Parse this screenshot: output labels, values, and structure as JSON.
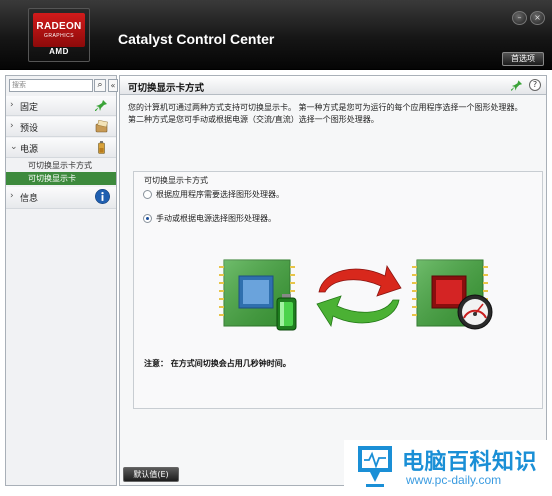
{
  "window": {
    "logo_brand": "RADEON",
    "logo_sub": "GRAPHICS",
    "logo_maker": "AMD",
    "title": "Catalyst Control Center",
    "minimize_symbol": "–",
    "close_symbol": "×",
    "preferences_label": "首选项"
  },
  "sidebar": {
    "search_placeholder": "搜索",
    "search_symbol": "⌕",
    "collapse_symbol": "«",
    "items": [
      {
        "label": "固定",
        "arrow": "›",
        "icon": "pin-icon"
      },
      {
        "label": "预设",
        "arrow": "›",
        "icon": "presets-icon"
      },
      {
        "label": "电源",
        "arrow": "⌄",
        "icon": "battery-icon"
      },
      {
        "label": "信息",
        "arrow": "›",
        "icon": "info-icon"
      }
    ],
    "sub_items": [
      {
        "label": "可切换显示卡方式"
      },
      {
        "label": "可切换显示卡",
        "selected": true
      }
    ]
  },
  "main": {
    "title": "可切换显示卡方式",
    "help_symbol": "?",
    "description_line1": "您的计算机可通过两种方式支持可切换显示卡。 第一种方式是您可为运行的每个应用程序选择一个图形处理器。",
    "description_line2": "第二种方式是您可手动或根据电源（交流/直流）选择一个图形处理器。",
    "group_title": "可切换显示卡方式",
    "options": [
      {
        "label": "根据应用程序需要选择图形处理器。",
        "checked": false
      },
      {
        "label": "手动或根据电源选择图形处理器。",
        "checked": true
      }
    ],
    "note": "注意： 在方式间切换会占用几秒钟时间。",
    "default_button": "默认值(E)"
  },
  "watermark": {
    "name": "电脑百科知识",
    "url": "www.pc-daily.com"
  },
  "colors": {
    "chip_green": "#3fa63a",
    "chip_blue": "#5a8fc8",
    "chip_red": "#c01818",
    "arrow_red": "#d8281c",
    "arrow_green": "#4bb134",
    "selection_green": "#3d8a3d",
    "watermark_blue": "#1a8fd6"
  }
}
